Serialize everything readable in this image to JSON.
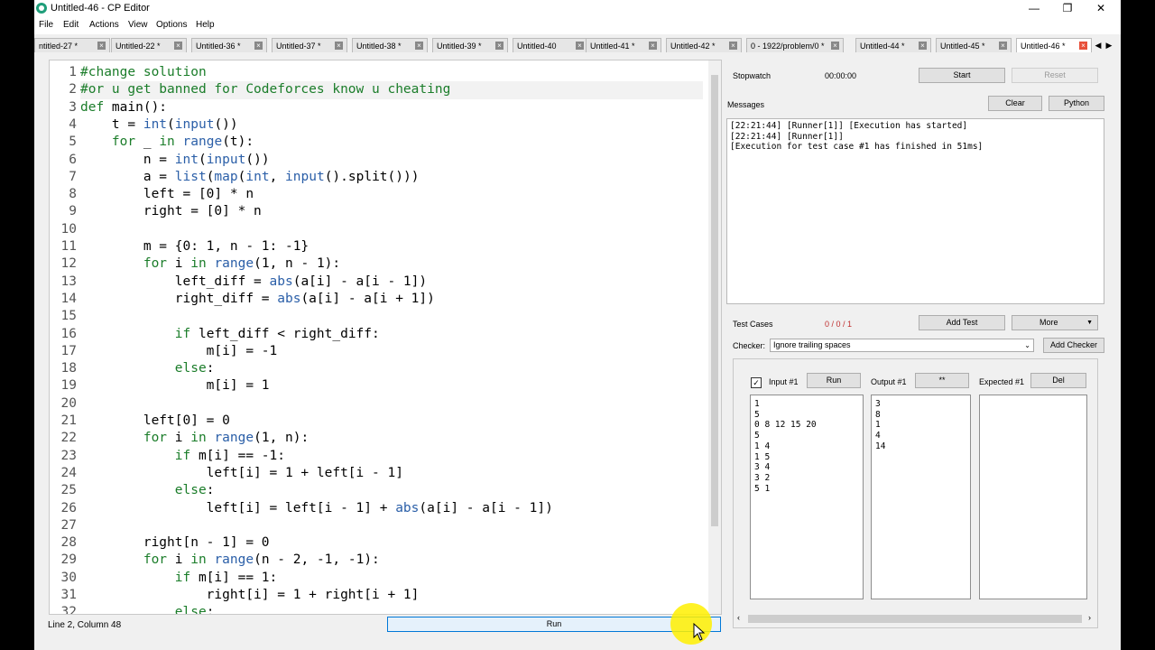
{
  "window": {
    "title": "Untitled-46 - CP Editor",
    "controls": {
      "minimize": "—",
      "maximize": "❐",
      "close": "✕"
    }
  },
  "menu": [
    "File",
    "Edit",
    "Actions",
    "View",
    "Options",
    "Help"
  ],
  "tabs": [
    "ntitled-27 *",
    "Untitled-22 *",
    "Untitled-36 *",
    "Untitled-37 *",
    "Untitled-38 *",
    "Untitled-39 *",
    "Untitled-40",
    "Untitled-41 *",
    "Untitled-42 *",
    "0 - 1922/problem/0 *",
    "Untitled-44 *",
    "Untitled-45 *",
    "Untitled-46 *"
  ],
  "editor": {
    "lines": [
      "#change solution",
      "#or u get banned for Codeforces know u cheating",
      "def main():",
      "    t = int(input())",
      "    for _ in range(t):",
      "        n = int(input())",
      "        a = list(map(int, input().split()))",
      "        left = [0] * n",
      "        right = [0] * n",
      "",
      "        m = {0: 1, n - 1: -1}",
      "        for i in range(1, n - 1):",
      "            left_diff = abs(a[i] - a[i - 1])",
      "            right_diff = abs(a[i] - a[i + 1])",
      "",
      "            if left_diff < right_diff:",
      "                m[i] = -1",
      "            else:",
      "                m[i] = 1",
      "",
      "        left[0] = 0",
      "        for i in range(1, n):",
      "            if m[i] == -1:",
      "                left[i] = 1 + left[i - 1]",
      "            else:",
      "                left[i] = left[i - 1] + abs(a[i] - a[i - 1])",
      "",
      "        right[n - 1] = 0",
      "        for i in range(n - 2, -1, -1):",
      "            if m[i] == 1:",
      "                right[i] = 1 + right[i + 1]",
      "            else:"
    ],
    "current_line": 2,
    "status": "Line 2, Column 48",
    "run_label": "Run"
  },
  "stopwatch": {
    "label": "Stopwatch",
    "time": "00:00:00",
    "start": "Start",
    "reset": "Reset"
  },
  "messages": {
    "label": "Messages",
    "clear": "Clear",
    "language": "Python",
    "lines": [
      "[22:21:44] [Runner[1]] [Execution has started]",
      "[22:21:44] [Runner[1]]",
      "[Execution for test case #1 has finished in 51ms]"
    ]
  },
  "tests": {
    "label": "Test Cases",
    "count": "0 / 0 / 1",
    "add_test": "Add Test",
    "more": "More",
    "checker_label": "Checker:",
    "checker_value": "Ignore trailing spaces",
    "add_checker": "Add Checker",
    "input_label": "Input #1",
    "run": "Run",
    "output_label": "Output #1",
    "output_btn": "**",
    "expected_label": "Expected #1",
    "del": "Del",
    "input_lines": [
      "1",
      "5",
      "0 8 12 15 20",
      "5",
      "1 4",
      "1 5",
      "3 4",
      "3 2",
      "5 1"
    ],
    "output_lines": [
      "3",
      "8",
      "1",
      "4",
      "14"
    ],
    "expected_lines": []
  },
  "colors": {
    "keyword": "#1b7d2a",
    "builtin": "#2b5fa8",
    "close_active": "#e8503a",
    "accent": "#0078d7"
  }
}
